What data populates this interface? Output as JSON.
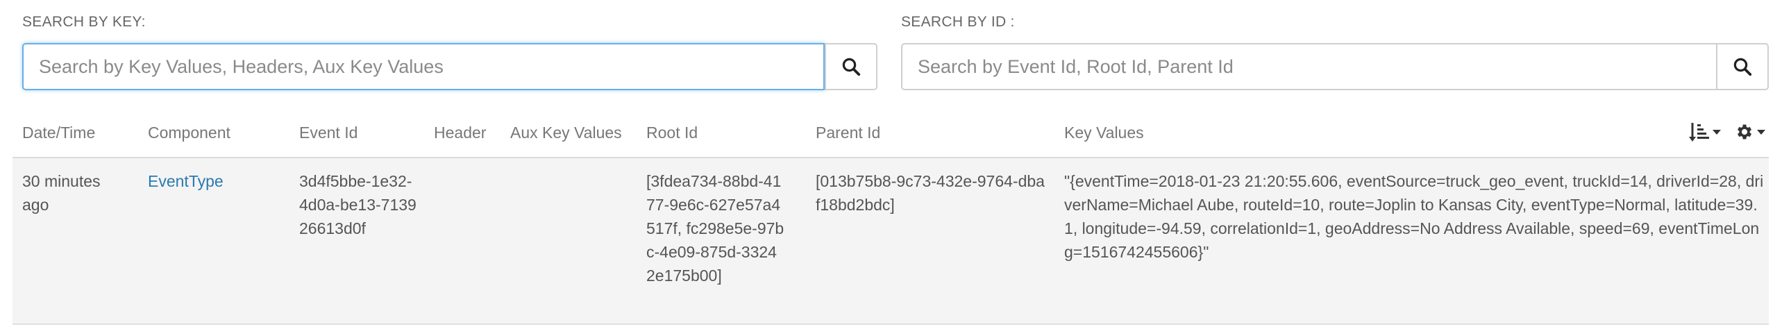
{
  "search_key": {
    "label": "SEARCH BY KEY:",
    "placeholder": "Search by Key Values, Headers, Aux Key Values",
    "value": ""
  },
  "search_id": {
    "label": "SEARCH BY ID :",
    "placeholder": "Search by Event Id, Root Id, Parent Id",
    "value": ""
  },
  "table": {
    "columns": {
      "datetime": "Date/Time",
      "component": "Component",
      "event_id": "Event Id",
      "header": "Header",
      "aux_key_values": "Aux Key Values",
      "root_id": "Root Id",
      "parent_id": "Parent Id",
      "key_values": "Key Values"
    },
    "rows": [
      {
        "datetime": "30 minutes ago",
        "component": "EventType",
        "event_id": "3d4f5bbe-1e32-4d0a-be13-713926613d0f",
        "header": "",
        "aux_key_values": "",
        "root_id": "[3fdea734-88bd-4177-9e6c-627e57a4517f, fc298e5e-97bc-4e09-875d-33242e175b00]",
        "parent_id": "[013b75b8-9c73-432e-9764-dbaf18bd2bdc]",
        "key_values": "\"{eventTime=2018-01-23 21:20:55.606, eventSource=truck_geo_event, truckId=14, driverId=28, driverName=Michael Aube, routeId=10, route=Joplin to Kansas City, eventType=Normal, latitude=39.1, longitude=-94.59, correlationId=1, geoAddress=No Address Available, speed=69, eventTimeLong=1516742455606}\""
      }
    ]
  },
  "icons": {
    "search": "search-icon",
    "sort": "sort-amount-icon",
    "settings": "gear-icon",
    "caret": "caret-down-icon"
  }
}
